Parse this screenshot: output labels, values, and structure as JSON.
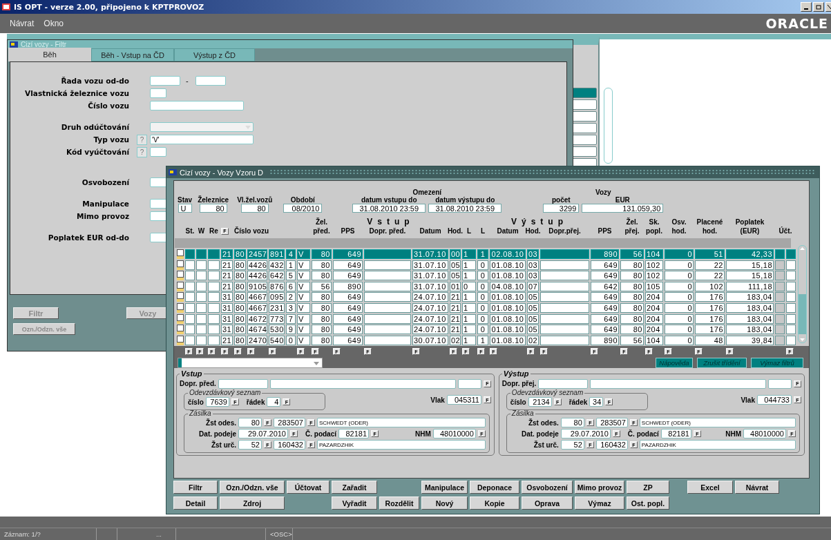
{
  "app": {
    "title": "IS OPT - verze 2.00, připojeno k KPTPROVOZ",
    "logo": "ORACLE"
  },
  "menu": [
    {
      "label": "Návrat"
    },
    {
      "label": "Okno"
    }
  ],
  "filter_window": {
    "title": "Cizí vozy - Filtr",
    "tabs": [
      {
        "label": "Běh",
        "selected": true
      },
      {
        "label": "Běh - Vstup na ČD",
        "selected": false
      },
      {
        "label": "Výstup z ČD",
        "selected": false
      }
    ],
    "fields": [
      {
        "kind": "range",
        "label": "Řada vozu od-do",
        "separator": "-"
      },
      {
        "kind": "short",
        "label": "Vlastnická železnice vozu"
      },
      {
        "kind": "long",
        "label": "Číslo vozu"
      },
      {
        "kind": "gap"
      },
      {
        "kind": "select",
        "label": "Druh odúčtování"
      },
      {
        "kind": "lookup-long",
        "label": "Typ vozu",
        "help": "?",
        "value": "'V'"
      },
      {
        "kind": "lookup-short",
        "label": "Kód vyúčtování",
        "help": "?"
      },
      {
        "kind": "gap"
      },
      {
        "kind": "gap"
      },
      {
        "kind": "medium",
        "label": "Osvobození"
      },
      {
        "kind": "gap"
      },
      {
        "kind": "medium",
        "label": "Manipulace"
      },
      {
        "kind": "medium",
        "label": "Mimo provoz"
      },
      {
        "kind": "gap"
      },
      {
        "kind": "medium",
        "label": "Poplatek EUR od-do"
      }
    ],
    "buttons": [
      "Filtr",
      "Vozy",
      "Ozn./Odzn. vše"
    ]
  },
  "main_window": {
    "title": "Cizí vozy - Vozy Vzoru D",
    "summary": {
      "fields": [
        {
          "label": "Stav",
          "value": "U"
        },
        {
          "label": "Železnice",
          "value": "80"
        },
        {
          "label": "Vl.žel.vozů",
          "value": "80"
        },
        {
          "label": "Období",
          "value": "08/2010"
        }
      ],
      "limits": {
        "title": "Omezení",
        "fields": [
          {
            "label": "datum vstupu do",
            "value": "31.08.2010 23:59"
          },
          {
            "label": "datum výstupu do",
            "value": "31.08.2010 23:59"
          }
        ]
      },
      "cars": {
        "title": "Vozy",
        "fields": [
          {
            "label": "počet",
            "value": "3299"
          },
          {
            "label": "EUR",
            "value": "131.059,30"
          }
        ]
      }
    },
    "groups": [
      "Vstup",
      "Výstup"
    ],
    "headers": [
      {
        "lines": [
          "St."
        ]
      },
      {
        "lines": [
          "W"
        ]
      },
      {
        "lines": [
          "Re"
        ]
      },
      {
        "lines": [
          "F"
        ],
        "kind": "button"
      },
      {
        "lines": [
          "Číslo vozu"
        ]
      },
      {
        "lines": [
          "Žel.",
          "před."
        ]
      },
      {
        "lines": [
          "PPS"
        ]
      },
      {
        "lines": [
          "Dopr. před."
        ]
      },
      {
        "lines": [
          "Datum"
        ]
      },
      {
        "lines": [
          "Hod."
        ]
      },
      {
        "lines": [
          "L"
        ]
      },
      {
        "lines": [
          "L"
        ]
      },
      {
        "lines": [
          "Datum"
        ]
      },
      {
        "lines": [
          "Hod."
        ]
      },
      {
        "lines": [
          "Dopr.přej."
        ]
      },
      {
        "lines": [
          "PPS"
        ]
      },
      {
        "lines": [
          "Žel.",
          "přej."
        ]
      },
      {
        "lines": [
          "Sk.",
          "popl."
        ]
      },
      {
        "lines": [
          "Osv.",
          "hod."
        ]
      },
      {
        "lines": [
          "Placené",
          "hod."
        ]
      },
      {
        "lines": [
          "Poplatek",
          "(EUR)"
        ]
      },
      {
        "lines": [
          "Účt."
        ]
      }
    ],
    "rows": [
      {
        "selected": true,
        "checked": false,
        "cells": [
          "21",
          "80",
          "2457",
          "891",
          "4",
          "V",
          "80",
          "649",
          "31.07.10",
          "00",
          "1",
          "1",
          "02.08.10",
          "03",
          "890",
          "56",
          "104",
          "0",
          "51",
          "42,33"
        ]
      },
      {
        "selected": false,
        "checked": false,
        "cells": [
          "21",
          "80",
          "4426",
          "432",
          "1",
          "V",
          "80",
          "649",
          "31.07.10",
          "05",
          "1",
          "0",
          "01.08.10",
          "03",
          "649",
          "80",
          "102",
          "0",
          "22",
          "15,18"
        ]
      },
      {
        "selected": false,
        "checked": false,
        "cells": [
          "21",
          "80",
          "4426",
          "642",
          "5",
          "V",
          "80",
          "649",
          "31.07.10",
          "05",
          "1",
          "0",
          "01.08.10",
          "03",
          "649",
          "80",
          "102",
          "0",
          "22",
          "15,18"
        ]
      },
      {
        "selected": false,
        "checked": false,
        "cells": [
          "21",
          "80",
          "9105",
          "876",
          "6",
          "V",
          "56",
          "890",
          "31.07.10",
          "01",
          "0",
          "0",
          "04.08.10",
          "07",
          "642",
          "80",
          "105",
          "0",
          "102",
          "111,18"
        ]
      },
      {
        "selected": false,
        "checked": false,
        "cells": [
          "31",
          "80",
          "4667",
          "095",
          "2",
          "V",
          "80",
          "649",
          "24.07.10",
          "21",
          "1",
          "0",
          "01.08.10",
          "05",
          "649",
          "80",
          "204",
          "0",
          "176",
          "183,04"
        ]
      },
      {
        "selected": false,
        "checked": false,
        "cells": [
          "31",
          "80",
          "4667",
          "231",
          "3",
          "V",
          "80",
          "649",
          "24.07.10",
          "21",
          "1",
          "0",
          "01.08.10",
          "05",
          "649",
          "80",
          "204",
          "0",
          "176",
          "183,04"
        ]
      },
      {
        "selected": false,
        "checked": false,
        "cells": [
          "31",
          "80",
          "4672",
          "773",
          "7",
          "V",
          "80",
          "649",
          "24.07.10",
          "21",
          "1",
          "0",
          "01.08.10",
          "05",
          "649",
          "80",
          "204",
          "0",
          "176",
          "183,04"
        ]
      },
      {
        "selected": false,
        "checked": false,
        "cells": [
          "31",
          "80",
          "4674",
          "530",
          "9",
          "V",
          "80",
          "649",
          "24.07.10",
          "21",
          "1",
          "0",
          "01.08.10",
          "05",
          "649",
          "80",
          "204",
          "0",
          "176",
          "183,04"
        ]
      },
      {
        "selected": false,
        "checked": false,
        "cells": [
          "21",
          "80",
          "2470",
          "540",
          "0",
          "V",
          "80",
          "649",
          "30.07.10",
          "02",
          "1",
          "1",
          "01.08.10",
          "02",
          "890",
          "56",
          "104",
          "0",
          "48",
          "39,84"
        ]
      }
    ],
    "filter_buttons": [
      "F",
      "F",
      "F",
      "F",
      "F",
      "F",
      "F",
      "F",
      "F",
      "F",
      "F",
      "F",
      "F",
      "F",
      "F",
      "F",
      "F",
      "F",
      "F",
      "F",
      "F",
      "F",
      "F",
      "F",
      "F"
    ],
    "tool_buttons": [
      "Nápověda",
      "Zrušit třídění",
      "Výmaz filtrů"
    ],
    "panels": [
      {
        "title": "Vstup",
        "carrier_label": "Dopr. před.",
        "list_title": "Odevzdávkový seznam",
        "number_label": "číslo",
        "number": "7639",
        "row_label": "řádek",
        "row": "4",
        "train_label": "Vlak",
        "train": "045311",
        "shipment_title": "Zásilka",
        "from_label": "Žst odes.",
        "from_rail": "80",
        "from_station": "283507",
        "from_name": "SCHWEDT (ODER)",
        "date_label": "Dat. podeje",
        "date": "29.07.2010",
        "waybill_label": "Č. podací",
        "waybill": "82181",
        "nhm_label": "NHM",
        "nhm": "48010000",
        "to_label": "Žst urč.",
        "to_rail": "52",
        "to_station": "160432",
        "to_name": "PAZARDZHIK",
        "f": [
          "F",
          "F",
          "F",
          "F",
          "F",
          "F",
          "F",
          "F",
          "F",
          "F",
          "F"
        ]
      },
      {
        "title": "Výstup",
        "carrier_label": "Dopr. přej.",
        "list_title": "Odevzdávkový seznam",
        "number_label": "číslo",
        "number": "2134",
        "row_label": "řádek",
        "row": "34",
        "train_label": "Vlak",
        "train": "044733",
        "shipment_title": "Zásilka",
        "from_label": "Žst odes.",
        "from_rail": "80",
        "from_station": "283507",
        "from_name": "SCHWEDT (ODER)",
        "date_label": "Dat. podeje",
        "date": "29.07.2010",
        "waybill_label": "Č. podací",
        "waybill": "82181",
        "nhm_label": "NHM",
        "nhm": "48010000",
        "to_label": "Žst urč.",
        "to_rail": "52",
        "to_station": "160432",
        "to_name": "PAZARDZHIK",
        "f": [
          "F",
          "F",
          "F",
          "F",
          "F",
          "F",
          "F",
          "F",
          "F",
          "F",
          "F"
        ]
      }
    ],
    "buttons": [
      [
        "Filtr",
        "Ozn./Odzn. vše",
        "Účtovat",
        "Zařadit",
        "Manipulace",
        "Deponace",
        "Osvobození",
        "Mimo provoz",
        "ZP",
        "Excel",
        "Návrat"
      ],
      [
        "Detail",
        "Zdroj",
        "Vyřadit",
        "Rozdělit",
        "Nový",
        "Kopie",
        "Oprava",
        "Výmaz",
        "Ost. popl."
      ]
    ]
  },
  "status_bar": {
    "record": "Záznam: 1/?",
    "ellipsis": "...",
    "mode": "<OSC>"
  }
}
